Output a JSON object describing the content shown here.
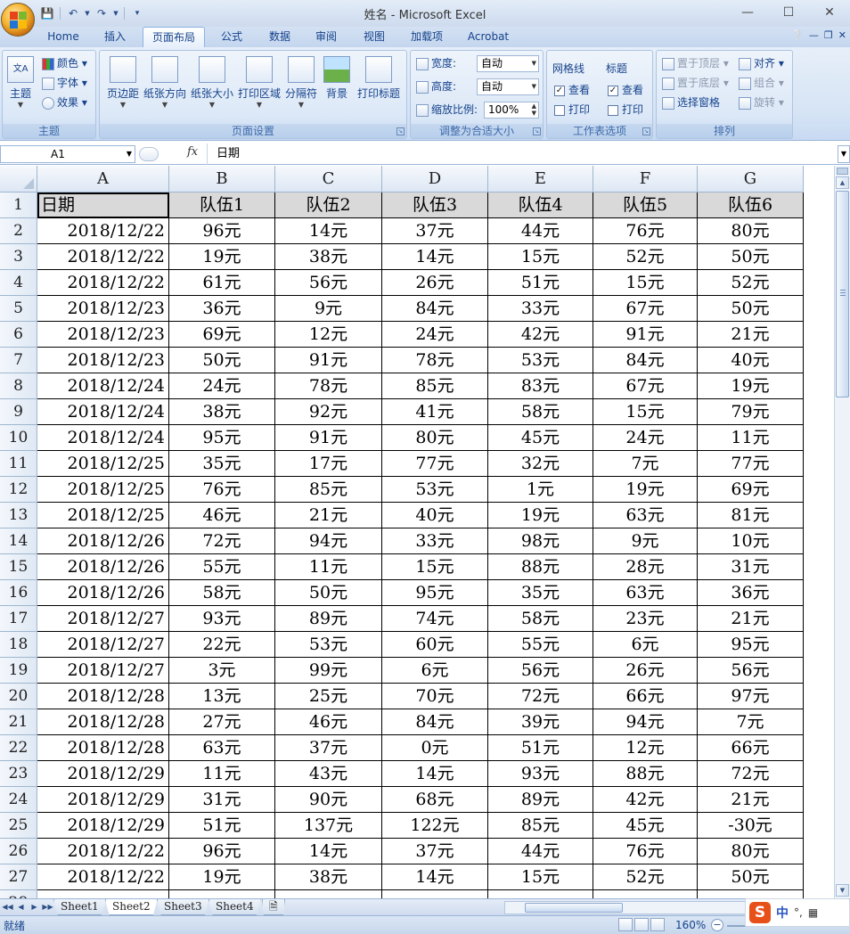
{
  "window": {
    "title": "姓名 - Microsoft Excel"
  },
  "tabs": [
    "Home",
    "插入",
    "页面布局",
    "公式",
    "数据",
    "审阅",
    "视图",
    "加载项",
    "Acrobat"
  ],
  "active_tab": "页面布局",
  "ribbon": {
    "theme": {
      "label": "主题",
      "main": "主题",
      "colors": "颜色",
      "fonts": "字体",
      "effects": "效果"
    },
    "page_setup": {
      "label": "页面设置",
      "buttons": [
        "页边距",
        "纸张方向",
        "纸张大小",
        "打印区域",
        "分隔符",
        "背景",
        "打印标题"
      ]
    },
    "scale": {
      "label": "调整为合适大小",
      "width_label": "宽度:",
      "width_value": "自动",
      "height_label": "高度:",
      "height_value": "自动",
      "scale_label": "缩放比例:",
      "scale_value": "100%"
    },
    "sheet_options": {
      "label": "工作表选项",
      "gridlines": "网格线",
      "headings": "标题",
      "view": "查看",
      "print": "打印"
    },
    "arrange": {
      "label": "排列",
      "bring_front": "置于顶层",
      "send_back": "置于底层",
      "selection_pane": "选择窗格",
      "align": "对齐",
      "group": "组合",
      "rotate": "旋转"
    }
  },
  "formula_bar": {
    "name_box": "A1",
    "fx": "fx",
    "content": "日期"
  },
  "sheet": {
    "columns": [
      "A",
      "B",
      "C",
      "D",
      "E",
      "F",
      "G"
    ],
    "header": [
      "日期",
      "队伍1",
      "队伍2",
      "队伍3",
      "队伍4",
      "队伍5",
      "队伍6"
    ],
    "rows": [
      [
        "2018/12/22",
        "96元",
        "14元",
        "37元",
        "44元",
        "76元",
        "80元"
      ],
      [
        "2018/12/22",
        "19元",
        "38元",
        "14元",
        "15元",
        "52元",
        "50元"
      ],
      [
        "2018/12/22",
        "61元",
        "56元",
        "26元",
        "51元",
        "15元",
        "52元"
      ],
      [
        "2018/12/23",
        "36元",
        "9元",
        "84元",
        "33元",
        "67元",
        "50元"
      ],
      [
        "2018/12/23",
        "69元",
        "12元",
        "24元",
        "42元",
        "91元",
        "21元"
      ],
      [
        "2018/12/23",
        "50元",
        "91元",
        "78元",
        "53元",
        "84元",
        "40元"
      ],
      [
        "2018/12/24",
        "24元",
        "78元",
        "85元",
        "83元",
        "67元",
        "19元"
      ],
      [
        "2018/12/24",
        "38元",
        "92元",
        "41元",
        "58元",
        "15元",
        "79元"
      ],
      [
        "2018/12/24",
        "95元",
        "91元",
        "80元",
        "45元",
        "24元",
        "11元"
      ],
      [
        "2018/12/25",
        "35元",
        "17元",
        "77元",
        "32元",
        "7元",
        "77元"
      ],
      [
        "2018/12/25",
        "76元",
        "85元",
        "53元",
        "1元",
        "19元",
        "69元"
      ],
      [
        "2018/12/25",
        "46元",
        "21元",
        "40元",
        "19元",
        "63元",
        "81元"
      ],
      [
        "2018/12/26",
        "72元",
        "94元",
        "33元",
        "98元",
        "9元",
        "10元"
      ],
      [
        "2018/12/26",
        "55元",
        "11元",
        "15元",
        "88元",
        "28元",
        "31元"
      ],
      [
        "2018/12/26",
        "58元",
        "50元",
        "95元",
        "35元",
        "63元",
        "36元"
      ],
      [
        "2018/12/27",
        "93元",
        "89元",
        "74元",
        "58元",
        "23元",
        "21元"
      ],
      [
        "2018/12/27",
        "22元",
        "53元",
        "60元",
        "55元",
        "6元",
        "95元"
      ],
      [
        "2018/12/27",
        "3元",
        "99元",
        "6元",
        "56元",
        "26元",
        "56元"
      ],
      [
        "2018/12/28",
        "13元",
        "25元",
        "70元",
        "72元",
        "66元",
        "97元"
      ],
      [
        "2018/12/28",
        "27元",
        "46元",
        "84元",
        "39元",
        "94元",
        "7元"
      ],
      [
        "2018/12/28",
        "63元",
        "37元",
        "0元",
        "51元",
        "12元",
        "66元"
      ],
      [
        "2018/12/29",
        "11元",
        "43元",
        "14元",
        "93元",
        "88元",
        "72元"
      ],
      [
        "2018/12/29",
        "31元",
        "90元",
        "68元",
        "89元",
        "42元",
        "21元"
      ],
      [
        "2018/12/29",
        "51元",
        "137元",
        "122元",
        "85元",
        "45元",
        "-30元"
      ],
      [
        "2018/12/22",
        "96元",
        "14元",
        "37元",
        "44元",
        "76元",
        "80元"
      ],
      [
        "2018/12/22",
        "19元",
        "38元",
        "14元",
        "15元",
        "52元",
        "50元"
      ]
    ]
  },
  "sheet_tabs": [
    "Sheet1",
    "Sheet2",
    "Sheet3",
    "Sheet4"
  ],
  "active_sheet": "Sheet2",
  "status": {
    "text": "就绪",
    "zoom": "160%"
  },
  "ime": {
    "mode": "中"
  }
}
